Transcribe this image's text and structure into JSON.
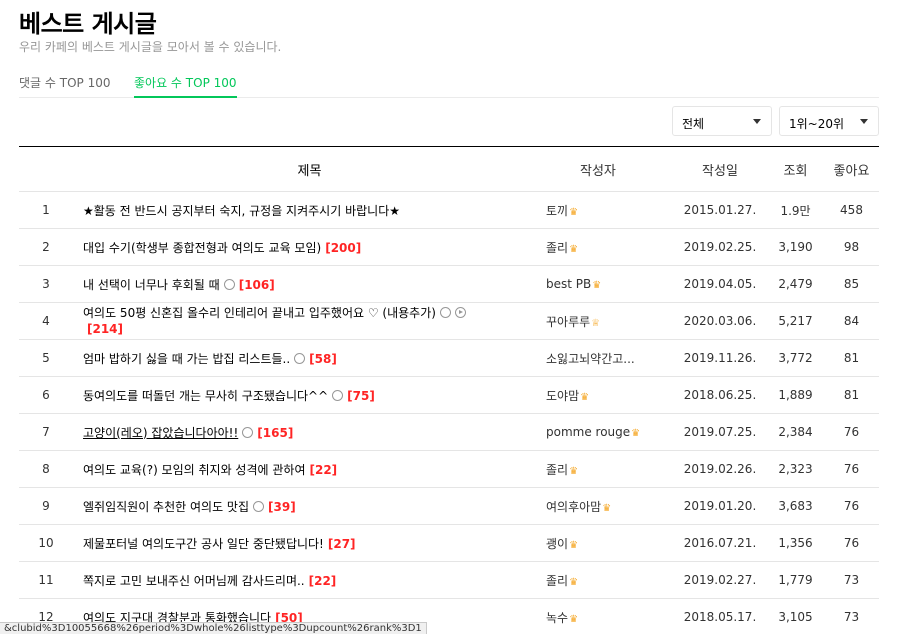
{
  "page": {
    "title": "베스트 게시글",
    "subtitle": "우리 카페의 베스트 게시글을 모아서 볼 수 있습니다."
  },
  "tabs": [
    {
      "label": "댓글 수 TOP 100",
      "active": false
    },
    {
      "label": "좋아요 수 TOP 100",
      "active": true
    }
  ],
  "filters": {
    "period": "전체",
    "rank_range": "1위~20위"
  },
  "table": {
    "headers": {
      "title": "제목",
      "author": "작성자",
      "date": "작성일",
      "views": "조회",
      "likes": "좋아요"
    },
    "rows": [
      {
        "rank": "1",
        "title": "★활동 전 반드시 공지부터 숙지, 규정을 지켜주시기 바랍니다★",
        "comments": "",
        "icons": [],
        "author": "토끼",
        "crown": "♛",
        "date": "2015.01.27.",
        "views": "1.9만",
        "likes": "458"
      },
      {
        "rank": "2",
        "title": "대입 수기(학생부 종합전형과 여의도 교육 모임)",
        "comments": "[200]",
        "icons": [],
        "author": "졸리",
        "crown": "♛",
        "date": "2019.02.25.",
        "views": "3,190",
        "likes": "98"
      },
      {
        "rank": "3",
        "title": "내 선택이 너무나 후회될 때",
        "comments": "[106]",
        "icons": [
          "image-icon"
        ],
        "author": "best PB",
        "crown": "♛",
        "date": "2019.04.05.",
        "views": "2,479",
        "likes": "85"
      },
      {
        "rank": "4",
        "title": "여의도 50평 신혼집 올수리 인테리어 끝내고 입주했어요 ♡ (내용추가)",
        "comments": "[214]",
        "icons": [
          "image-icon",
          "video-icon"
        ],
        "author": "꾸아루루",
        "crown": "♕",
        "date": "2020.03.06.",
        "views": "5,217",
        "likes": "84"
      },
      {
        "rank": "5",
        "title": "엄마 밥하기 싫을 때 가는 밥집 리스트들..",
        "comments": "[58]",
        "icons": [
          "image-icon"
        ],
        "author": "소잃고뇌약간고...",
        "crown": "",
        "date": "2019.11.26.",
        "views": "3,772",
        "likes": "81"
      },
      {
        "rank": "6",
        "title": "동여의도를 떠돌던 개는 무사히 구조됐습니다^^",
        "comments": "[75]",
        "icons": [
          "image-icon"
        ],
        "author": "도야맘",
        "crown": "♛",
        "date": "2018.06.25.",
        "views": "1,889",
        "likes": "81"
      },
      {
        "rank": "7",
        "title": "고양이(레오) 잡았습니다아아!!",
        "comments": "[165]",
        "icons": [
          "image-icon"
        ],
        "author": "pomme rouge",
        "crown": "♛",
        "date": "2019.07.25.",
        "views": "2,384",
        "likes": "76"
      },
      {
        "rank": "8",
        "title": "여의도 교육(?) 모임의 취지와 성격에 관하여",
        "comments": "[22]",
        "icons": [],
        "author": "졸리",
        "crown": "♛",
        "date": "2019.02.26.",
        "views": "2,323",
        "likes": "76"
      },
      {
        "rank": "9",
        "title": "엘쥐임직원이 추천한 여의도 맛집",
        "comments": "[39]",
        "icons": [
          "image-icon"
        ],
        "author": "여의후아맘",
        "crown": "♛",
        "date": "2019.01.20.",
        "views": "3,683",
        "likes": "76"
      },
      {
        "rank": "10",
        "title": "제물포터널 여의도구간 공사 일단 중단됐답니다!",
        "comments": "[27]",
        "icons": [],
        "author": "괭이",
        "crown": "♛",
        "date": "2016.07.21.",
        "views": "1,356",
        "likes": "76"
      },
      {
        "rank": "11",
        "title": "쪽지로 고민 보내주신 어머님께 감사드리며..",
        "comments": "[22]",
        "icons": [],
        "author": "졸리",
        "crown": "♛",
        "date": "2019.02.27.",
        "views": "1,779",
        "likes": "73"
      },
      {
        "rank": "12",
        "title": "여의도 지구대 경찰분과 통화했습니다",
        "comments": "[50]",
        "icons": [],
        "author": "녹수",
        "crown": "♛",
        "date": "2018.05.17.",
        "views": "3,105",
        "likes": "73"
      }
    ]
  },
  "status_bar": "&clubid%3D10055668%26period%3Dwhole%26listtype%3Dupcount%26rank%3D1",
  "colors": {
    "accent": "#03c75a",
    "comment_count": "#ff2424",
    "subtitle": "#979797"
  }
}
